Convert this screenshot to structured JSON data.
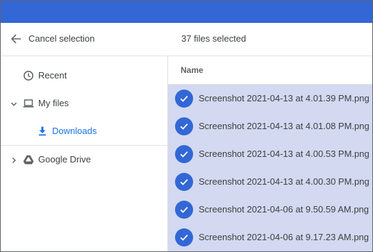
{
  "header": {
    "cancel_label": "Cancel selection",
    "selected_count": "37 files selected"
  },
  "sidebar": {
    "items": [
      {
        "label": "Recent",
        "icon": "clock-icon"
      },
      {
        "label": "My files",
        "icon": "laptop-icon"
      },
      {
        "label": "Downloads",
        "icon": "download-icon"
      },
      {
        "label": "Google Drive",
        "icon": "drive-icon"
      }
    ]
  },
  "files": {
    "column_name": "Name",
    "rows": [
      {
        "name": "Screenshot 2021-04-13 at 4.01.39 PM.png"
      },
      {
        "name": "Screenshot 2021-04-13 at 4.01.08 PM.png"
      },
      {
        "name": "Screenshot 2021-04-13 at 4.00.53 PM.png"
      },
      {
        "name": "Screenshot 2021-04-13 at 4.00.30 PM.png"
      },
      {
        "name": "Screenshot 2021-04-06 at 9.50.59 AM.png"
      },
      {
        "name": "Screenshot 2021-04-06 at 9.17.23 AM.png"
      }
    ]
  },
  "colors": {
    "top_bar": "#3367d6",
    "selection_row": "#d2d9f0",
    "check_circle": "#3367d6",
    "active_nav": "#1a73e8"
  }
}
